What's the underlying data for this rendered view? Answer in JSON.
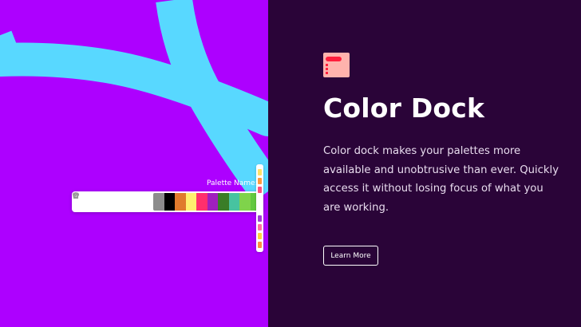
{
  "hero": {
    "title": "Color Dock",
    "description": "Color dock makes your palettes more available and unobtrusive than ever. Quickly access it without losing focus of what you are working.",
    "cta_label": "Learn More"
  },
  "dock": {
    "palette_name_label": "Palette Name:",
    "tools": [
      "link-icon",
      "trash-icon",
      "lock-icon",
      "copy-icon",
      "heart-icon"
    ],
    "swatches": [
      "#8c8c8c",
      "#000000",
      "#e07b2c",
      "#fff06e",
      "#ff2f6d",
      "#a01fbd",
      "#3a7d27",
      "#47c3a0",
      "#7fd34b",
      "#62c93f"
    ]
  },
  "side_strip": {
    "chips": [
      "#ffe066",
      "#ff9a3c",
      "#ff4f7e",
      "#a53bd6",
      "#ff6fa0",
      "#ffd23f",
      "#ff8c42"
    ]
  },
  "colors": {
    "canvas_bg": "#ad00ff",
    "brush": "#58d8ff",
    "panel_bg": "#2a0438",
    "logo_bg": "#ffb3ad",
    "logo_accent": "#ff1e3c"
  }
}
